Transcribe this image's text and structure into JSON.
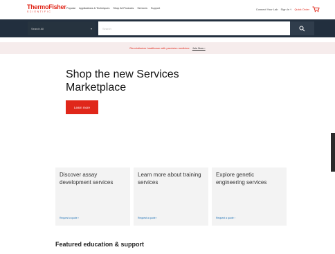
{
  "header": {
    "logo_main": "ThermoFisher",
    "logo_sub": "SCIENTIFIC",
    "nav": [
      "Popular",
      "Applications & Techniques",
      "Shop All Products",
      "Services",
      "Support"
    ],
    "util": {
      "connect": "Connect Your Lab",
      "signin": "Sign In ˅",
      "quick_order": "Quick Order"
    }
  },
  "search": {
    "scope": "Search All",
    "placeholder": "Search"
  },
  "promo": {
    "text": "Revolutionize healthcare with precision medicine.",
    "link": "Join Now ›"
  },
  "hero": {
    "title": "Shop the new Services Marketplace",
    "button": "Learn more"
  },
  "cards": [
    {
      "title": "Discover assay development services",
      "link": "Request a quote ›"
    },
    {
      "title": "Learn more about training services",
      "link": "Request a quote ›"
    },
    {
      "title": "Explore genetic engineering services",
      "link": "Request a quote ›"
    }
  ],
  "featured_heading": "Featured education & support",
  "colors": {
    "brand_red": "#e0271a",
    "search_bar": "#222f3e",
    "promo_bg": "#f6ecec",
    "card_bg": "#f3f3f3",
    "link_blue": "#1a6fb5"
  }
}
